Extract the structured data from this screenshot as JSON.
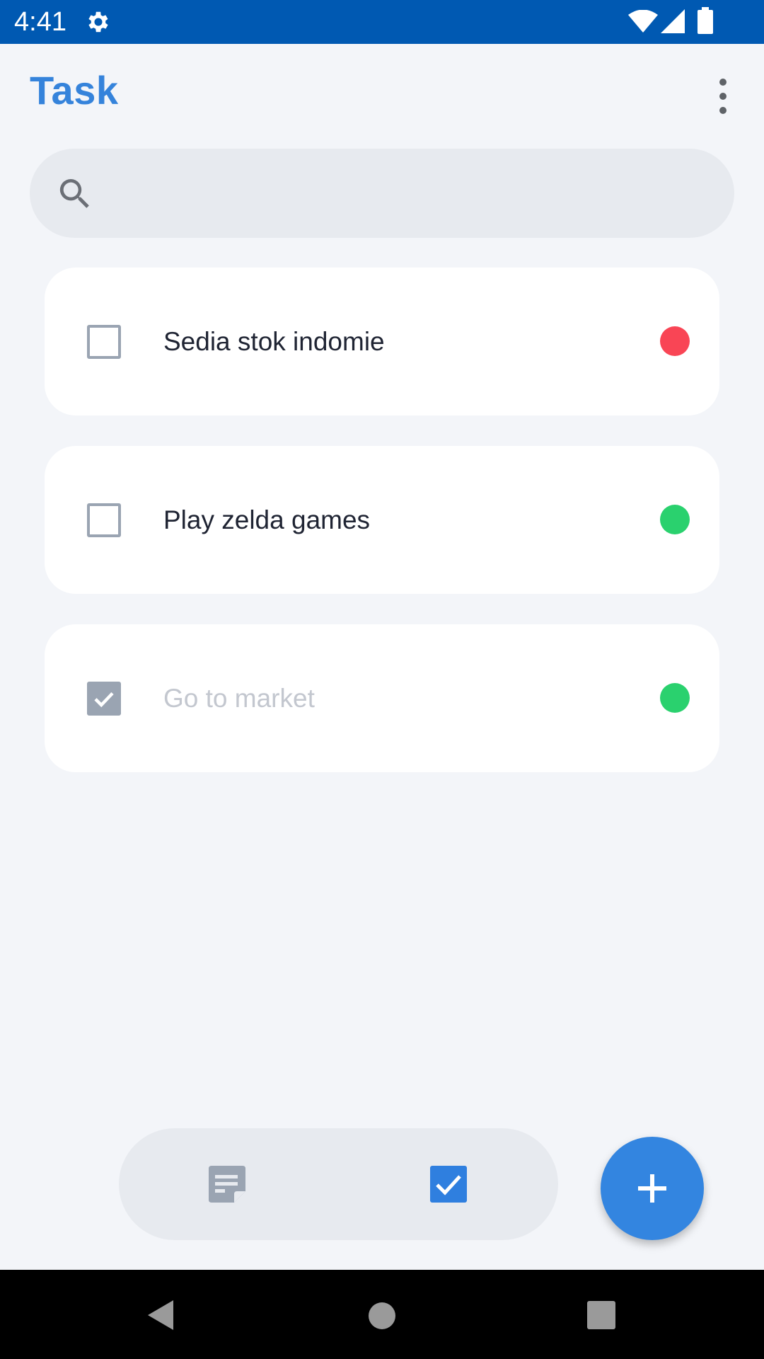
{
  "status_bar": {
    "time": "4:41",
    "icons": [
      "gear-icon",
      "wifi-icon",
      "signal-icon",
      "battery-icon"
    ]
  },
  "header": {
    "title": "Task",
    "menu_icon": "more-vertical-icon"
  },
  "search": {
    "icon": "search-icon",
    "placeholder": ""
  },
  "tasks": [
    {
      "label": "Sedia stok indomie",
      "checked": false,
      "priority_color": "#f94555"
    },
    {
      "label": "Play zelda games",
      "checked": false,
      "priority_color": "#2ad16e"
    },
    {
      "label": "Go to market",
      "checked": true,
      "priority_color": "#2ad16e"
    }
  ],
  "bottom_nav": {
    "items": [
      {
        "icon": "notes-icon",
        "active": false
      },
      {
        "icon": "tasks-checkbox-icon",
        "active": true
      }
    ]
  },
  "fab": {
    "icon": "plus-icon"
  },
  "colors": {
    "accent": "#3583db",
    "status_bar": "#0059b2",
    "background": "#f3f5f9",
    "unchecked_border": "#9aa4b2",
    "completed_text": "#c3c7cf"
  }
}
